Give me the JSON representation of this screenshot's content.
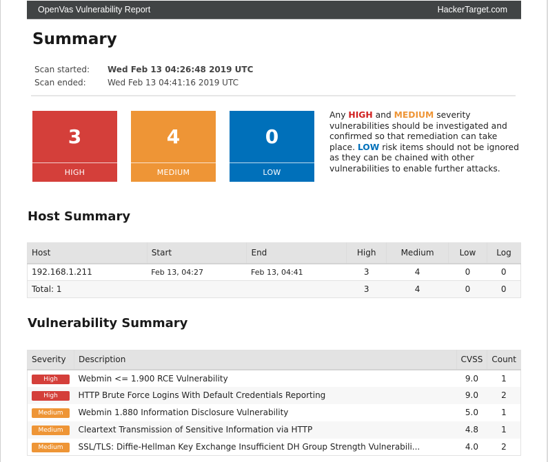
{
  "header": {
    "title": "OpenVas Vulnerability Report",
    "brand": "HackerTarget.com"
  },
  "summary": {
    "title": "Summary",
    "scan_started_label": "Scan started:",
    "scan_started_value": "Wed Feb 13 04:26:48 2019 UTC",
    "scan_ended_label": "Scan ended:",
    "scan_ended_value": "Wed Feb 13 04:41:16 2019 UTC"
  },
  "severity_counts": {
    "high": {
      "count": "3",
      "label": "HIGH",
      "color": "#d43f3a"
    },
    "medium": {
      "count": "4",
      "label": "MEDIUM",
      "color": "#ee9536"
    },
    "low": {
      "count": "0",
      "label": "LOW",
      "color": "#0070ba"
    }
  },
  "advice": {
    "part1": "Any ",
    "high": "HIGH",
    "part2": " and ",
    "medium": "MEDIUM",
    "part3": " severity vulnerabilities should be investigated and confirmed so that remediation can take place. ",
    "low": "LOW",
    "part4": " risk items should not be ignored as they can be chained with other vulnerabilities to enable further attacks."
  },
  "host_summary": {
    "title": "Host Summary",
    "columns": [
      "Host",
      "Start",
      "End",
      "High",
      "Medium",
      "Low",
      "Log"
    ],
    "rows": [
      {
        "host": "192.168.1.211",
        "start": "Feb 13, 04:27",
        "end": "Feb 13, 04:41",
        "high": "3",
        "medium": "4",
        "low": "0",
        "log": "0"
      }
    ],
    "total": {
      "label": "Total: 1",
      "high": "3",
      "medium": "4",
      "low": "0",
      "log": "0"
    }
  },
  "vulnerability_summary": {
    "title": "Vulnerability Summary",
    "columns": [
      "Severity",
      "Description",
      "CVSS",
      "Count"
    ],
    "rows": [
      {
        "severity": "High",
        "description": "Webmin <= 1.900 RCE Vulnerability",
        "cvss": "9.0",
        "count": "1"
      },
      {
        "severity": "High",
        "description": "HTTP Brute Force Logins With Default Credentials Reporting",
        "cvss": "9.0",
        "count": "2"
      },
      {
        "severity": "Medium",
        "description": "Webmin 1.880 Information Disclosure Vulnerability",
        "cvss": "5.0",
        "count": "1"
      },
      {
        "severity": "Medium",
        "description": "Cleartext Transmission of Sensitive Information via HTTP",
        "cvss": "4.8",
        "count": "1"
      },
      {
        "severity": "Medium",
        "description": "SSL/TLS: Diffie-Hellman Key Exchange Insufficient DH Group Strength Vulnerabili...",
        "cvss": "4.0",
        "count": "2"
      }
    ]
  }
}
